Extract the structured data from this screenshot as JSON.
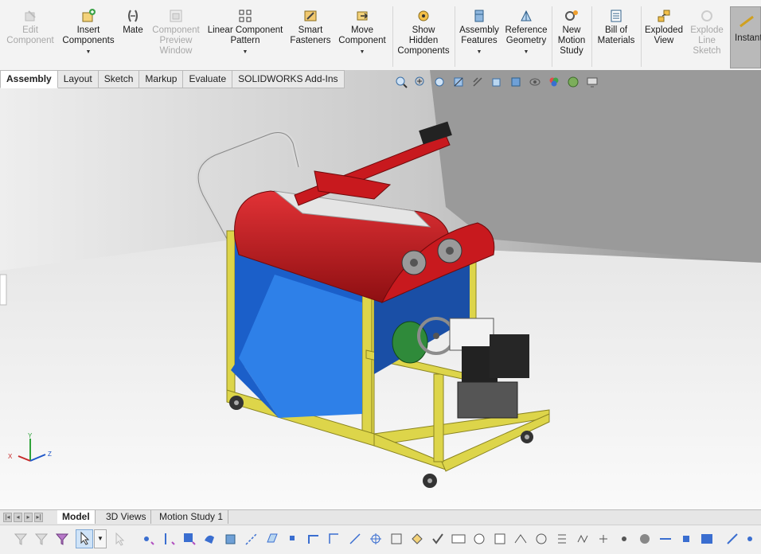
{
  "ribbon": {
    "buttons": [
      {
        "label_lines": [
          "Edit",
          "Component"
        ],
        "icon": "edit-component-icon",
        "disabled": true
      },
      {
        "label_lines": [
          "Insert",
          "Components"
        ],
        "icon": "insert-components-icon",
        "caret": true
      },
      {
        "label_lines": [
          "Mate"
        ],
        "icon": "mate-icon"
      },
      {
        "label_lines": [
          "Component",
          "Preview",
          "Window"
        ],
        "icon": "component-preview-icon",
        "disabled": true
      },
      {
        "label_lines": [
          "Linear Component",
          "Pattern"
        ],
        "icon": "linear-pattern-icon",
        "caret": true
      },
      {
        "label_lines": [
          "Smart",
          "Fasteners"
        ],
        "icon": "smart-fasteners-icon"
      },
      {
        "label_lines": [
          "Move",
          "Component"
        ],
        "icon": "move-component-icon",
        "caret": true
      },
      {
        "label_lines": [
          "Show",
          "Hidden",
          "Components"
        ],
        "icon": "show-hidden-icon"
      },
      {
        "label_lines": [
          "Assembly",
          "Features"
        ],
        "icon": "assembly-features-icon",
        "caret": true
      },
      {
        "label_lines": [
          "Reference",
          "Geometry"
        ],
        "icon": "reference-geometry-icon",
        "caret": true
      },
      {
        "label_lines": [
          "New",
          "Motion",
          "Study"
        ],
        "icon": "motion-study-icon"
      },
      {
        "label_lines": [
          "Bill of",
          "Materials"
        ],
        "icon": "bill-of-materials-icon"
      },
      {
        "label_lines": [
          "Exploded",
          "View"
        ],
        "icon": "exploded-view-icon"
      },
      {
        "label_lines": [
          "Explode",
          "Line",
          "Sketch"
        ],
        "icon": "explode-line-sketch-icon",
        "disabled": true
      }
    ],
    "instant_label": "Instant"
  },
  "command_tabs": [
    "Assembly",
    "Layout",
    "Sketch",
    "Markup",
    "Evaluate",
    "SOLIDWORKS Add-Ins"
  ],
  "bottom_tabs": [
    "Model",
    "3D Views",
    "Motion Study 1"
  ],
  "triad": {
    "x": "X",
    "y": "Y",
    "z": "Z"
  },
  "colors": {
    "hopper_red": "#c8191e",
    "body_blue": "#1b5fc9",
    "frame_yellow": "#ddd54a",
    "gearbox_green": "#2f8a3a",
    "engine_black": "#222222"
  }
}
